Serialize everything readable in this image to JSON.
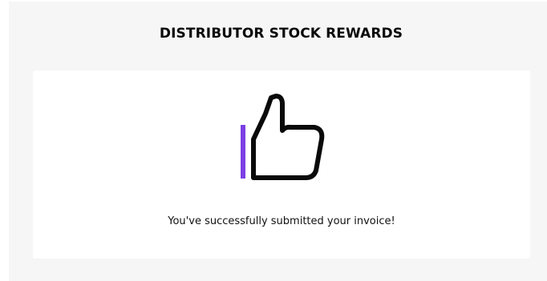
{
  "page": {
    "title": "DISTRIBUTOR STOCK REWARDS"
  },
  "confirmation": {
    "icon": "thumbs-up-icon",
    "message": "You've successfully submitted your invoice!"
  },
  "colors": {
    "page_background": "#f6f6f6",
    "card_background": "#ffffff",
    "icon_stroke": "#0a0a0a",
    "accent": "#7b3fe4"
  }
}
